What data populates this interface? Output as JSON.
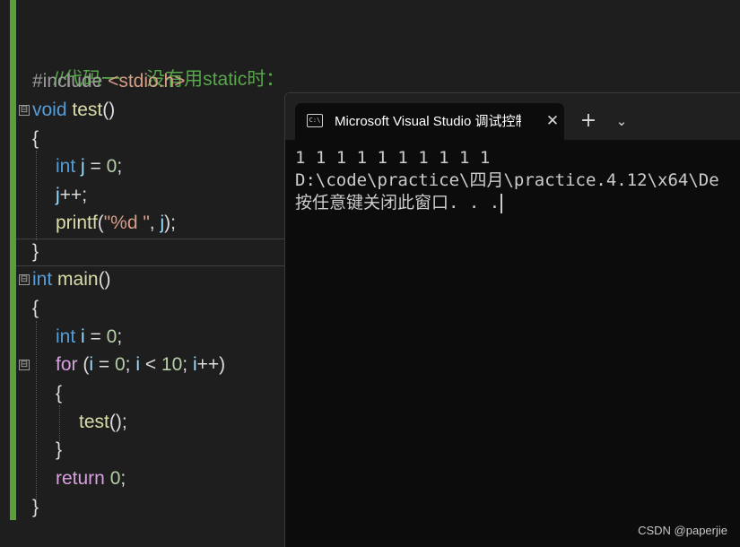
{
  "editor": {
    "accent_color": "#5a9e3a",
    "lines": {
      "comment": "//代码一     没有用static时：",
      "include_directive": "#include",
      "include_header": "<stdio.h>",
      "l3_kw": "void",
      "l3_fn": "test",
      "l3_rest": "()",
      "l4": "{",
      "l5_kw": "int",
      "l5_var": "j",
      "l5_op": " = ",
      "l5_num": "0",
      "l5_end": ";",
      "l6_var": "j",
      "l6_rest": "++;",
      "l7_fn": "printf",
      "l7_p1": "(",
      "l7_str": "\"%d \"",
      "l7_p2": ", ",
      "l7_var": "j",
      "l7_end": ");",
      "l8": "}",
      "l9_kw": "int",
      "l9_fn": "main",
      "l9_rest": "()",
      "l10": "{",
      "l11_kw": "int",
      "l11_var": "i",
      "l11_op": " = ",
      "l11_num": "0",
      "l11_end": ";",
      "l12_ctl": "for",
      "l12_a": " (",
      "l12_v1": "i",
      "l12_b": " = ",
      "l12_n1": "0",
      "l12_c": "; ",
      "l12_v2": "i",
      "l12_d": " < ",
      "l12_n2": "10",
      "l12_e": "; ",
      "l12_v3": "i",
      "l12_f": "++)",
      "l13": "{",
      "l14_fn": "test",
      "l14_rest": "();",
      "l15": "}",
      "l16_ctl": "return",
      "l16_sp": " ",
      "l16_num": "0",
      "l16_end": ";",
      "l17": "}"
    },
    "fold_glyph": "⊟"
  },
  "console": {
    "tab_icon_text": "C:\\",
    "tab_title": "Microsoft Visual Studio 调试控制台",
    "close_glyph": "✕",
    "add_glyph": "+",
    "dropdown_glyph": "⌄",
    "output": [
      "1 1 1 1 1 1 1 1 1 1",
      "D:\\code\\practice\\四月\\practice.4.12\\x64\\De",
      "按任意键关闭此窗口. . ."
    ]
  },
  "watermark": "CSDN @paperjie"
}
